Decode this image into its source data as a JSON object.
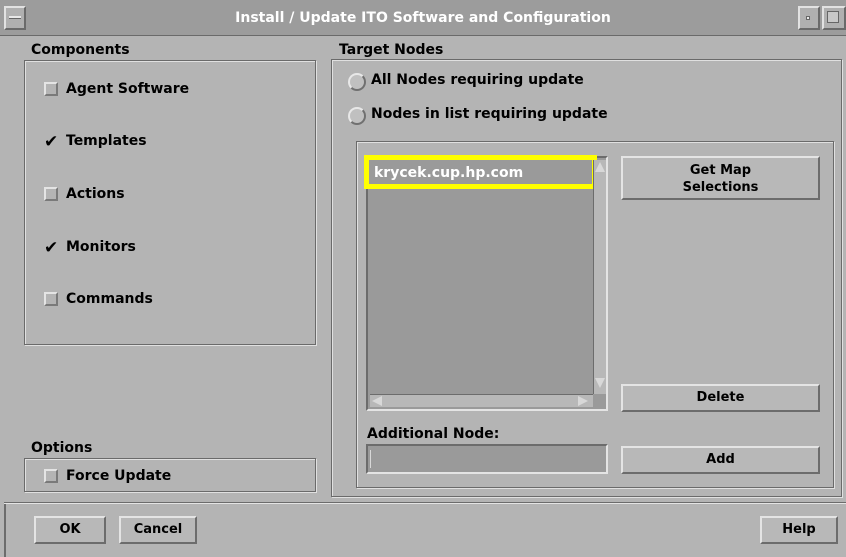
{
  "window": {
    "title": "Install / Update ITO Software and Configuration"
  },
  "components": {
    "heading": "Components",
    "items": [
      {
        "label": "Agent Software",
        "checked": false
      },
      {
        "label": "Templates",
        "checked": true
      },
      {
        "label": "Actions",
        "checked": false
      },
      {
        "label": "Monitors",
        "checked": true
      },
      {
        "label": "Commands",
        "checked": false
      }
    ]
  },
  "options": {
    "heading": "Options",
    "force_update_label": "Force Update",
    "force_update_checked": false
  },
  "target_nodes": {
    "heading": "Target Nodes",
    "radio_all_label": "All Nodes requiring update",
    "radio_list_label": "Nodes in list requiring update",
    "node_list": [
      "krycek.cup.hp.com"
    ],
    "get_map_button_line1": "Get Map",
    "get_map_button_line2": "Selections",
    "delete_button": "Delete",
    "additional_node_label": "Additional Node:",
    "additional_node_value": "",
    "add_button": "Add"
  },
  "footer": {
    "ok": "OK",
    "cancel": "Cancel",
    "help": "Help"
  },
  "colors": {
    "highlight": "#ffff00",
    "list_bg": "#9a9a9a",
    "window_bg": "#b4b4b4"
  }
}
